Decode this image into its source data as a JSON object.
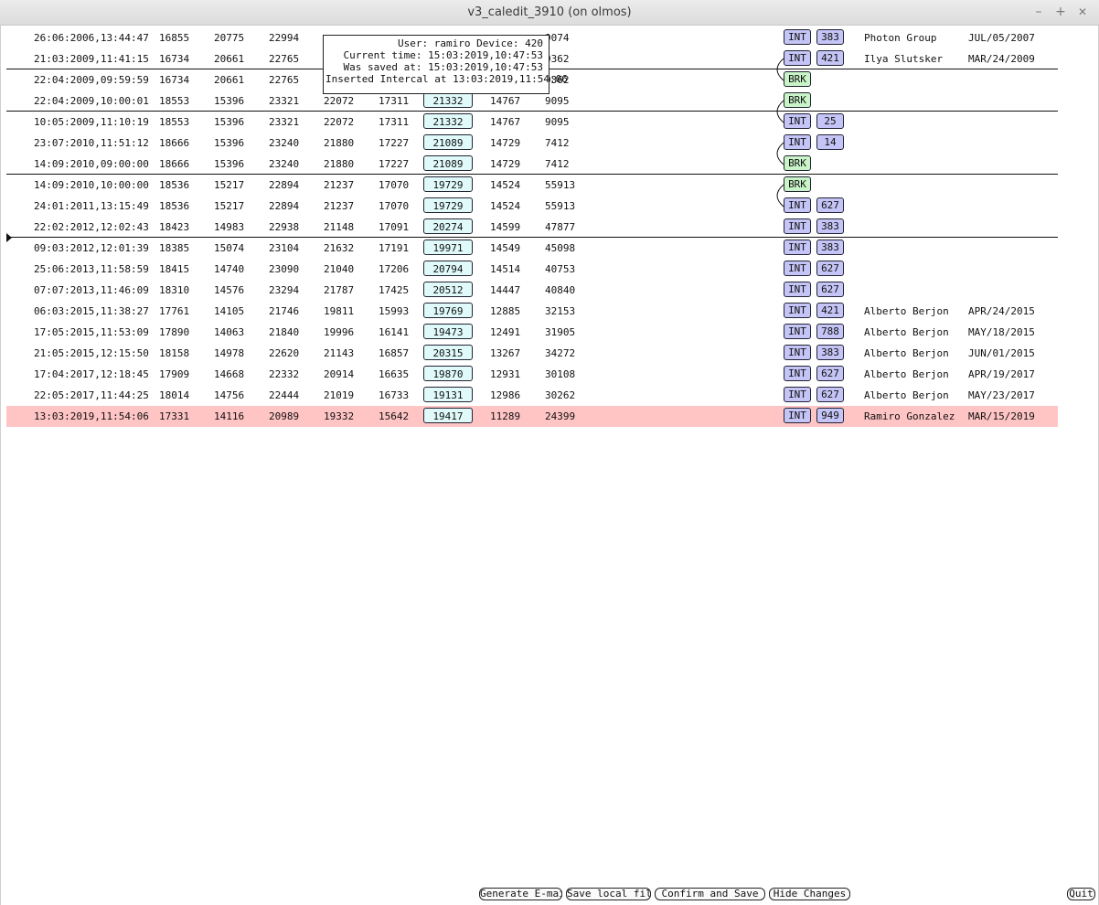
{
  "window": {
    "title": "v3_caledit_3910 (on olmos)",
    "minimize": "–",
    "maximize": "+",
    "close": "✕"
  },
  "tooltip": {
    "line1": "User: ramiro Device: 420",
    "line2": "Current time: 15:03:2019,10:47:53",
    "line3": "Was saved at: 15:03:2019,10:47:53",
    "line4": "Inserted Intercal at 13:03:2019,11:54:06"
  },
  "rows": [
    {
      "date": "26:06:2006,13:44:47",
      "v1": "16855",
      "v2": "20775",
      "v3": "22994",
      "v4": "",
      "v5": "",
      "v6": "",
      "v7": "",
      "v8": "9074",
      "type": "INT",
      "num": "383",
      "user": "Photon Group",
      "udate": "JUL/05/2007"
    },
    {
      "date": "21:03:2009,11:41:15",
      "v1": "16734",
      "v2": "20661",
      "v3": "22765",
      "v4": "",
      "v5": "",
      "v6": "",
      "v7": "",
      "v8": "9362",
      "type": "INT",
      "num": "421",
      "user": "Ilya Slutsker",
      "udate": "MAR/24/2009"
    },
    {
      "date": "22:04:2009,09:59:59",
      "v1": "16734",
      "v2": "20661",
      "v3": "22765",
      "v4": "",
      "v5": "",
      "v6": "",
      "v7": "",
      "v8": "9362",
      "type": "BRK",
      "num": "",
      "user": "",
      "udate": ""
    },
    {
      "date": "22:04:2009,10:00:01",
      "v1": "18553",
      "v2": "15396",
      "v3": "23321",
      "v4": "22072",
      "v5": "17311",
      "v6": "21332",
      "v7": "14767",
      "v8": "9095",
      "type": "BRK",
      "num": "",
      "user": "",
      "udate": ""
    },
    {
      "date": "10:05:2009,11:10:19",
      "v1": "18553",
      "v2": "15396",
      "v3": "23321",
      "v4": "22072",
      "v5": "17311",
      "v6": "21332",
      "v7": "14767",
      "v8": "9095",
      "type": "INT",
      "num": "25",
      "user": "",
      "udate": ""
    },
    {
      "date": "23:07:2010,11:51:12",
      "v1": "18666",
      "v2": "15396",
      "v3": "23240",
      "v4": "21880",
      "v5": "17227",
      "v6": "21089",
      "v7": "14729",
      "v8": "7412",
      "type": "INT",
      "num": "14",
      "user": "",
      "udate": ""
    },
    {
      "date": "14:09:2010,09:00:00",
      "v1": "18666",
      "v2": "15396",
      "v3": "23240",
      "v4": "21880",
      "v5": "17227",
      "v6": "21089",
      "v7": "14729",
      "v8": "7412",
      "type": "BRK",
      "num": "",
      "user": "",
      "udate": ""
    },
    {
      "date": "14:09:2010,10:00:00",
      "v1": "18536",
      "v2": "15217",
      "v3": "22894",
      "v4": "21237",
      "v5": "17070",
      "v6": "19729",
      "v7": "14524",
      "v8": "55913",
      "type": "BRK",
      "num": "",
      "user": "",
      "udate": ""
    },
    {
      "date": "24:01:2011,13:15:49",
      "v1": "18536",
      "v2": "15217",
      "v3": "22894",
      "v4": "21237",
      "v5": "17070",
      "v6": "19729",
      "v7": "14524",
      "v8": "55913",
      "type": "INT",
      "num": "627",
      "user": "",
      "udate": ""
    },
    {
      "date": "22:02:2012,12:02:43",
      "v1": "18423",
      "v2": "14983",
      "v3": "22938",
      "v4": "21148",
      "v5": "17091",
      "v6": "20274",
      "v7": "14599",
      "v8": "47877",
      "type": "INT",
      "num": "383",
      "user": "",
      "udate": ""
    },
    {
      "date": "09:03:2012,12:01:39",
      "v1": "18385",
      "v2": "15074",
      "v3": "23104",
      "v4": "21632",
      "v5": "17191",
      "v6": "19971",
      "v7": "14549",
      "v8": "45098",
      "type": "INT",
      "num": "383",
      "user": "",
      "udate": ""
    },
    {
      "date": "25:06:2013,11:58:59",
      "v1": "18415",
      "v2": "14740",
      "v3": "23090",
      "v4": "21040",
      "v5": "17206",
      "v6": "20794",
      "v7": "14514",
      "v8": "40753",
      "type": "INT",
      "num": "627",
      "user": "",
      "udate": ""
    },
    {
      "date": "07:07:2013,11:46:09",
      "v1": "18310",
      "v2": "14576",
      "v3": "23294",
      "v4": "21787",
      "v5": "17425",
      "v6": "20512",
      "v7": "14447",
      "v8": "40840",
      "type": "INT",
      "num": "627",
      "user": "",
      "udate": ""
    },
    {
      "date": "06:03:2015,11:38:27",
      "v1": "17761",
      "v2": "14105",
      "v3": "21746",
      "v4": "19811",
      "v5": "15993",
      "v6": "19769",
      "v7": "12885",
      "v8": "32153",
      "type": "INT",
      "num": "421",
      "user": "Alberto Berjon",
      "udate": "APR/24/2015"
    },
    {
      "date": "17:05:2015,11:53:09",
      "v1": "17890",
      "v2": "14063",
      "v3": "21840",
      "v4": "19996",
      "v5": "16141",
      "v6": "19473",
      "v7": "12491",
      "v8": "31905",
      "type": "INT",
      "num": "788",
      "user": "Alberto Berjon",
      "udate": "MAY/18/2015"
    },
    {
      "date": "21:05:2015,12:15:50",
      "v1": "18158",
      "v2": "14978",
      "v3": "22620",
      "v4": "21143",
      "v5": "16857",
      "v6": "20315",
      "v7": "13267",
      "v8": "34272",
      "type": "INT",
      "num": "383",
      "user": "Alberto Berjon",
      "udate": "JUN/01/2015"
    },
    {
      "date": "17:04:2017,12:18:45",
      "v1": "17909",
      "v2": "14668",
      "v3": "22332",
      "v4": "20914",
      "v5": "16635",
      "v6": "19870",
      "v7": "12931",
      "v8": "30108",
      "type": "INT",
      "num": "627",
      "user": "Alberto Berjon",
      "udate": "APR/19/2017"
    },
    {
      "date": "22:05:2017,11:44:25",
      "v1": "18014",
      "v2": "14756",
      "v3": "22444",
      "v4": "21019",
      "v5": "16733",
      "v6": "19131",
      "v7": "12986",
      "v8": "30262",
      "type": "INT",
      "num": "627",
      "user": "Alberto Berjon",
      "udate": "MAY/23/2017"
    },
    {
      "date": "13:03:2019,11:54:06",
      "v1": "17331",
      "v2": "14116",
      "v3": "20989",
      "v4": "19332",
      "v5": "15642",
      "v6": "19417",
      "v7": "11289",
      "v8": "24399",
      "type": "INT",
      "num": "949",
      "user": "Ramiro Gonzalez",
      "udate": "MAR/15/2019"
    }
  ],
  "buttons": {
    "generate_email": "Generate E-mail",
    "save_local": "Save local file",
    "confirm_save": "Confirm and Save",
    "hide_changes": "Hide Changes",
    "quit": "Quit"
  }
}
